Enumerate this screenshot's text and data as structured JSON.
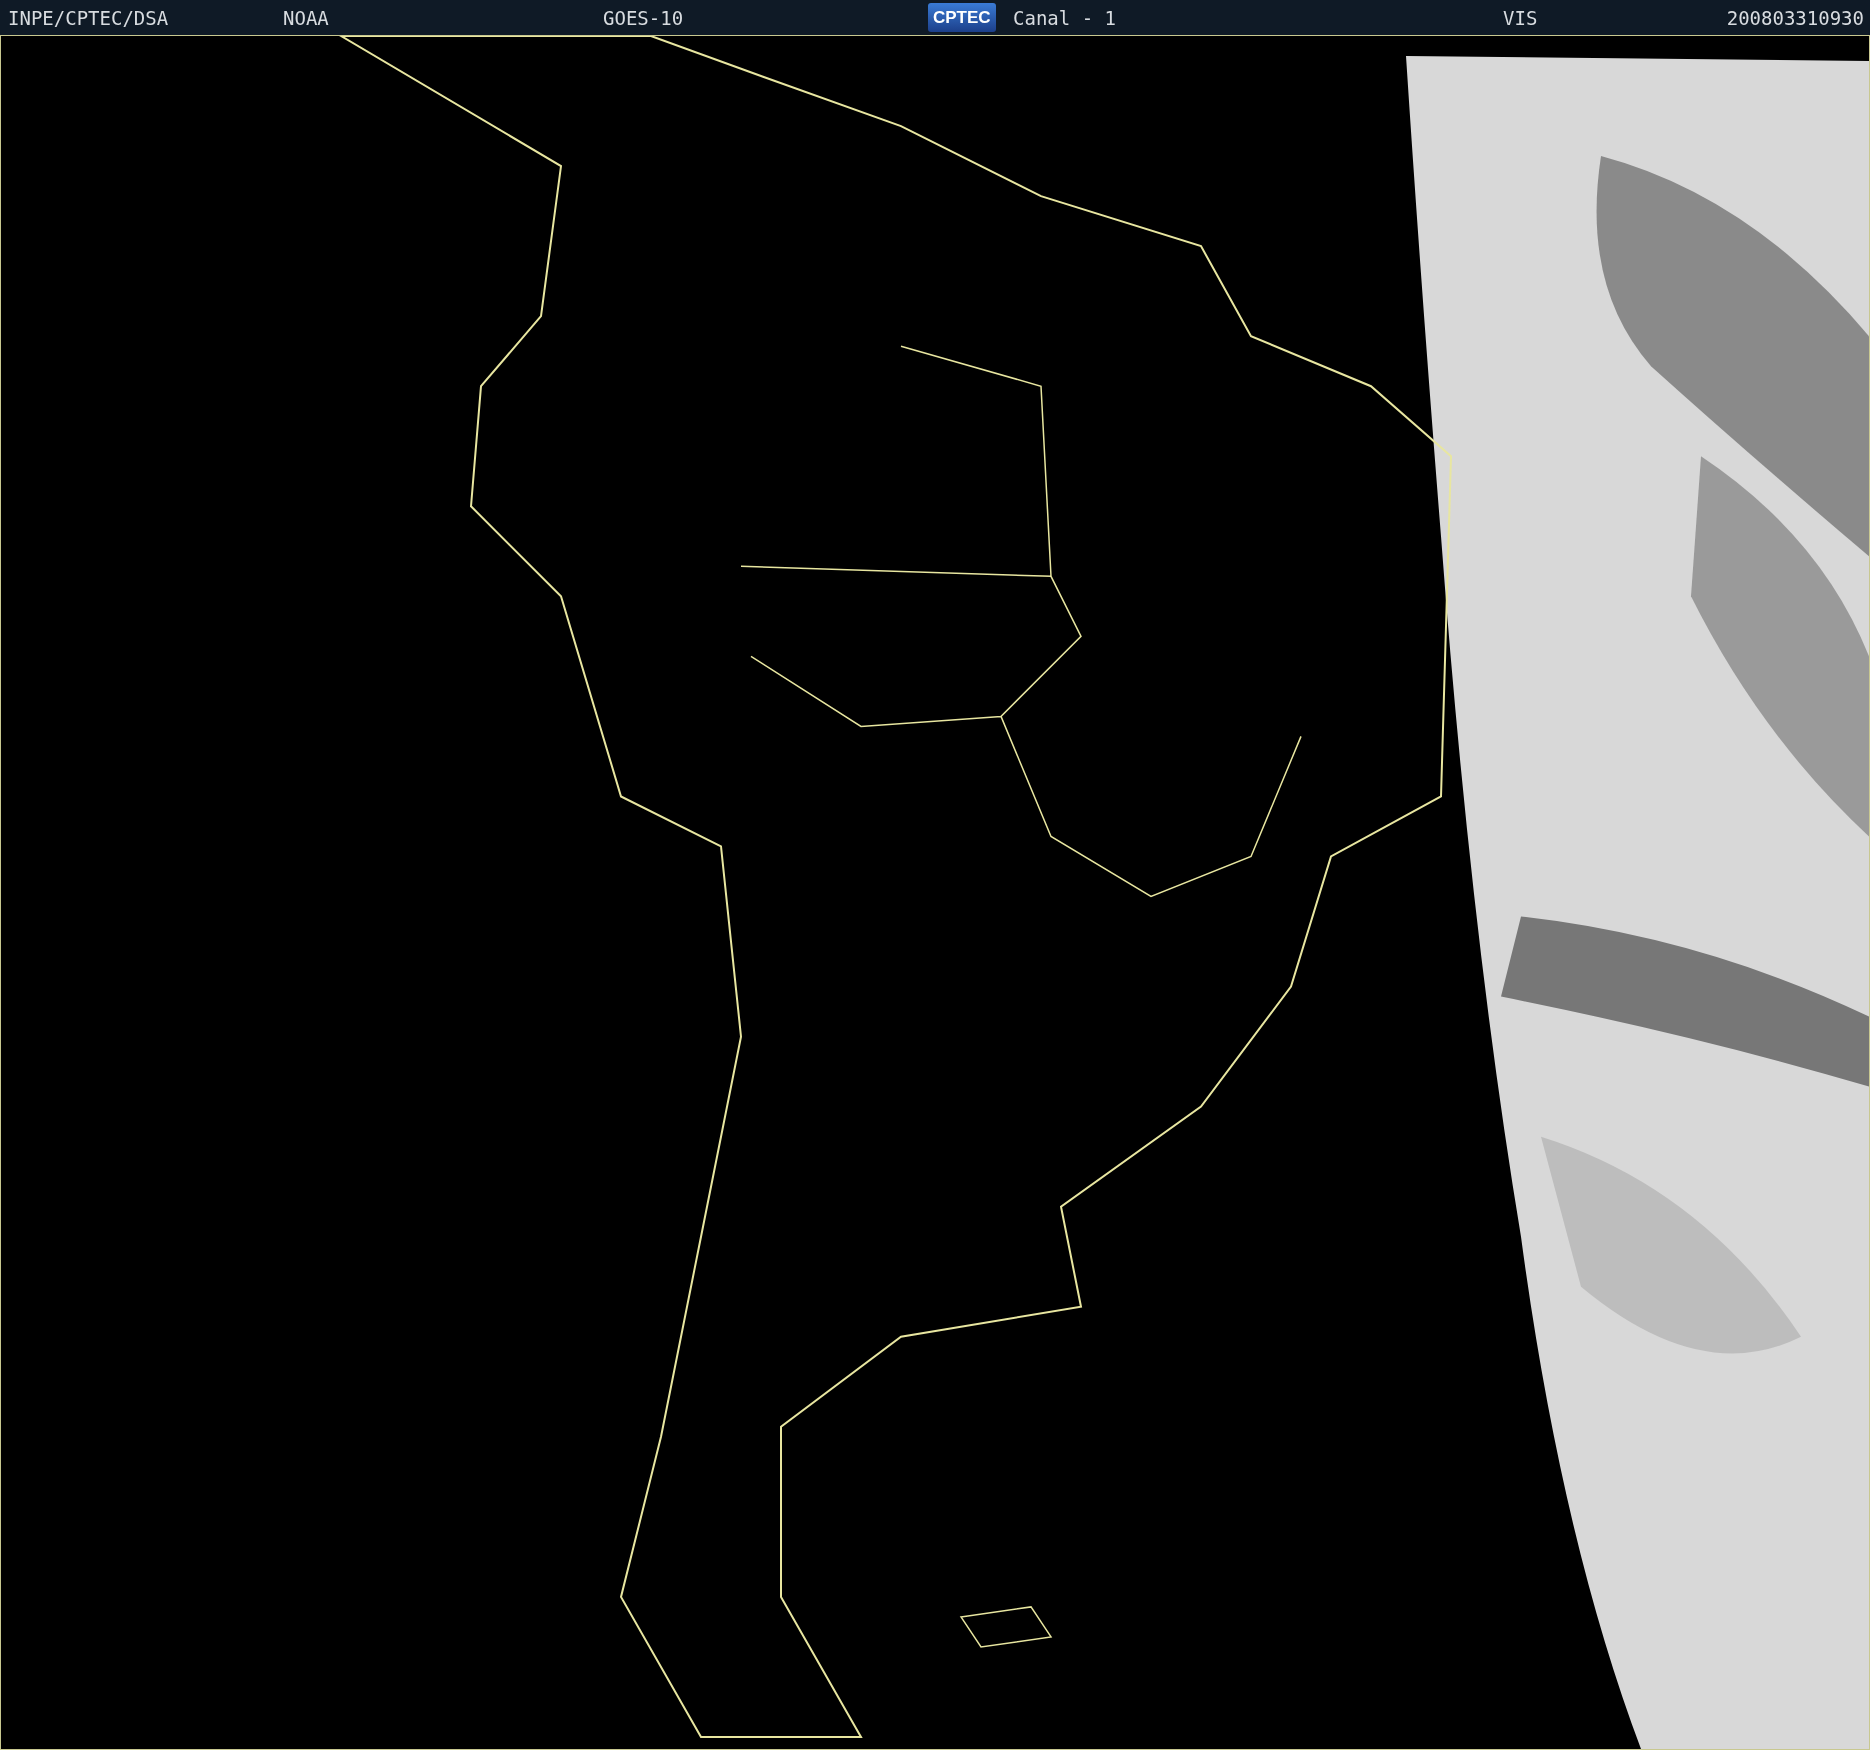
{
  "header": {
    "source": "INPE/CPTEC/DSA",
    "agency": "NOAA",
    "satellite": "GOES-10",
    "logo_text": "CPTEC",
    "channel": "Canal - 1",
    "band": "VIS",
    "timestamp": "200803310930"
  }
}
